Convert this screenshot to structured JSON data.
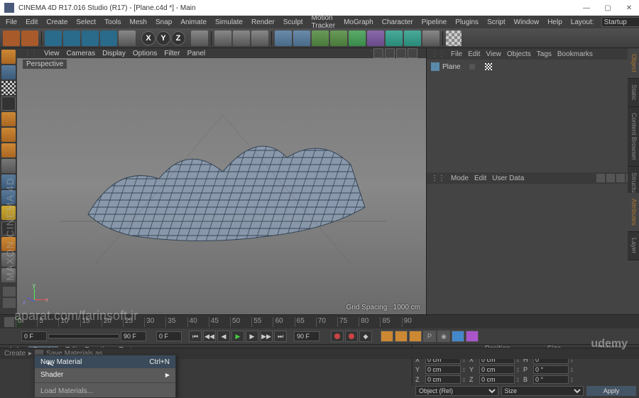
{
  "window": {
    "title": "CINEMA 4D R17.016 Studio (R17) - [Plane.c4d *] - Main",
    "layout_label": "Layout:",
    "layout_value": "Startup"
  },
  "menubar": [
    "File",
    "Edit",
    "Create",
    "Select",
    "Tools",
    "Mesh",
    "Snap",
    "Animate",
    "Simulate",
    "Render",
    "Sculpt",
    "Motion Tracker",
    "MoGraph",
    "Character",
    "Pipeline",
    "Plugins",
    "Script",
    "Window",
    "Help"
  ],
  "axes": [
    "X",
    "Y",
    "Z"
  ],
  "viewport": {
    "menu": [
      "View",
      "Cameras",
      "Display",
      "Options",
      "Filter",
      "Panel"
    ],
    "label": "Perspective",
    "grid_spacing": "Grid Spacing : 1000 cm"
  },
  "object_manager": {
    "menu": [
      "File",
      "Edit",
      "View",
      "Objects",
      "Tags",
      "Bookmarks"
    ],
    "items": [
      {
        "name": "Plane"
      }
    ],
    "tabs": [
      "Object",
      "Static",
      "Content Browser",
      "Structure"
    ]
  },
  "attributes": {
    "menu": [
      "Mode",
      "Edit",
      "User Data"
    ],
    "tabs": [
      "Attributes",
      "Layer"
    ]
  },
  "timeline": {
    "ticks": [
      "0",
      "5",
      "10",
      "15",
      "20",
      "25",
      "30",
      "35",
      "40",
      "45",
      "50",
      "55",
      "60",
      "65",
      "70",
      "75",
      "80",
      "85",
      "90"
    ],
    "start": "0 F",
    "end": "90 F",
    "current": "0 F",
    "range_end": "90 F"
  },
  "material": {
    "menu": [
      "Create",
      "Edit",
      "Function",
      "Texture"
    ],
    "context": {
      "new_material": "New Material",
      "new_material_key": "Ctrl+N",
      "shader": "Shader",
      "load": "Load Materials...",
      "save": "Save Materials as..."
    }
  },
  "coords": {
    "headers": [
      "Position",
      "Size",
      "Rotation"
    ],
    "rows": [
      {
        "axis": "X",
        "pos": "0 cm",
        "size": "0 cm",
        "rot_label": "H",
        "rot": "0 °"
      },
      {
        "axis": "Y",
        "pos": "0 cm",
        "size": "0 cm",
        "rot_label": "P",
        "rot": "0 °"
      },
      {
        "axis": "Z",
        "pos": "0 cm",
        "size": "0 cm",
        "rot_label": "B",
        "rot": "0 °"
      }
    ],
    "mode1": "Object (Rel)",
    "mode2": "Size",
    "apply": "Apply"
  },
  "status": {
    "create": "Create",
    "hint": "Save Materials as..."
  },
  "branding": {
    "maxon": "MAXON CINEMA 4D",
    "aparat": "aparat.com/farinsoft.ir",
    "udemy": "udemy"
  }
}
